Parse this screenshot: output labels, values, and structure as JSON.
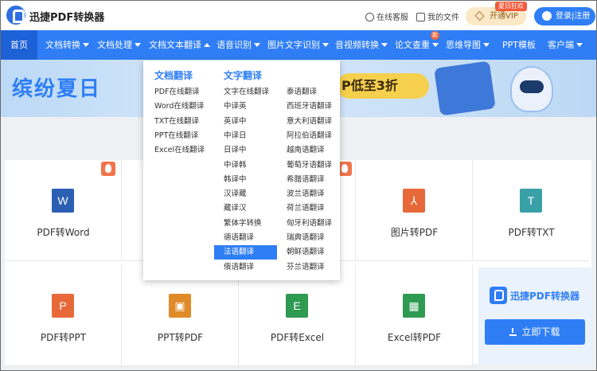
{
  "app": {
    "name": "迅捷PDF转换器"
  },
  "topbar": {
    "service_label": "在线客服",
    "files_label": "我的文件",
    "vip_label": "开通VIP",
    "vip_tag": "夏日狂欢",
    "login_label": "登录|注册"
  },
  "nav": {
    "items": [
      {
        "label": "首页"
      },
      {
        "label": "文档转换"
      },
      {
        "label": "文档处理"
      },
      {
        "label": "文档文本翻译"
      },
      {
        "label": "语音识别"
      },
      {
        "label": "图片文字识别"
      },
      {
        "label": "音视频转换"
      },
      {
        "label": "论文查重"
      },
      {
        "label": "思维导图"
      },
      {
        "label": "PPT模板"
      },
      {
        "label": "客户端"
      }
    ],
    "new_badge": "新"
  },
  "banner": {
    "title": "缤纷夏日",
    "promo": "P低至3折"
  },
  "dropdown": {
    "doc_heading": "文档翻译",
    "text_heading": "文字翻译",
    "doc_items": [
      "PDF在线翻译",
      "Word在线翻译",
      "TXT在线翻译",
      "PPT在线翻译",
      "Excel在线翻译"
    ],
    "text_col1": [
      "文字在线翻译",
      "中译英",
      "英译中",
      "中译日",
      "日译中",
      "中译韩",
      "韩译中",
      "汉译藏",
      "藏译汉",
      "繁体字转换",
      "德语翻译",
      "法语翻译",
      "俄语翻译"
    ],
    "text_col2": [
      "泰语翻译",
      "西班牙语翻译",
      "意大利语翻译",
      "阿拉伯语翻译",
      "越南语翻译",
      "葡萄牙语翻译",
      "希腊语翻译",
      "波兰语翻译",
      "荷兰语翻译",
      "匈牙利语翻译",
      "瑞典语翻译",
      "朝鲜语翻译",
      "芬兰语翻译"
    ],
    "selected": "法语翻译"
  },
  "tools": {
    "row1": [
      {
        "label": "PDF转Word",
        "glyph": "W",
        "color": "#2b5fb4"
      },
      {
        "label": "",
        "glyph": "",
        "color": ""
      },
      {
        "label": "",
        "glyph": "",
        "color": ""
      },
      {
        "label": "图片转PDF",
        "glyph": "⅄",
        "color": "#e7693a"
      },
      {
        "label": "PDF转TXT",
        "glyph": "T",
        "color": "#3aa0a8"
      }
    ],
    "row2": [
      {
        "label": "PDF转PPT",
        "glyph": "P",
        "color": "#e7693a"
      },
      {
        "label": "PPT转PDF",
        "glyph": "▣",
        "color": "#e08a2a"
      },
      {
        "label": "PDF转Excel",
        "glyph": "E",
        "color": "#2f9a52"
      },
      {
        "label": "Excel转PDF",
        "glyph": "▦",
        "color": "#2f9a52"
      }
    ]
  },
  "download": {
    "app_name": "迅捷PDF转换器",
    "button_label": "立即下载"
  }
}
